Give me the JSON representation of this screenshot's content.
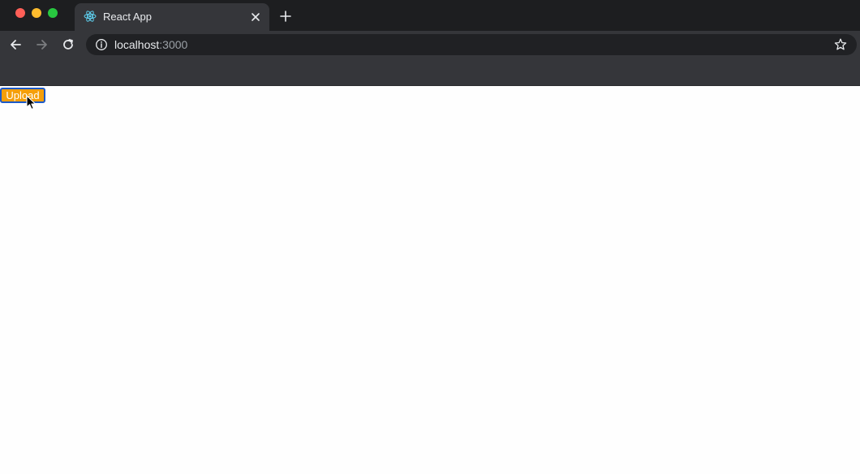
{
  "browser": {
    "tab": {
      "title": "React App",
      "icon": "react-logo-icon"
    },
    "toolbar": {
      "url_host": "localhost",
      "url_port": ":3000",
      "icons": [
        "back-arrow-icon",
        "forward-arrow-icon",
        "reload-icon",
        "info-icon",
        "star-icon"
      ]
    },
    "colors": {
      "chrome_dark": "#1d1e20",
      "chrome_toolbar": "#35363a",
      "omnibox": "#202124",
      "upload_button_bg": "#f59f0a",
      "upload_button_border": "#1c5ac9"
    }
  },
  "page": {
    "upload_label": "Upload"
  }
}
